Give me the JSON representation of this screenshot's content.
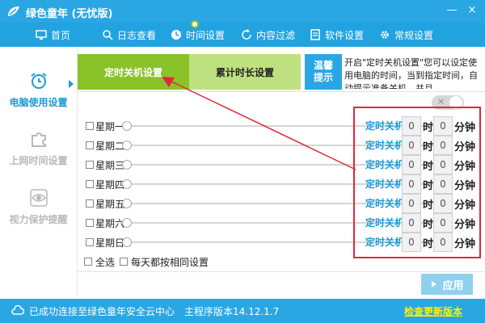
{
  "app": {
    "title": "绿色童年 (无忧版)"
  },
  "window_controls": {
    "minimize": "—",
    "close": "×"
  },
  "menu": [
    {
      "label": "首页",
      "icon": "monitor-icon"
    },
    {
      "label": "日志查看",
      "icon": "search-icon"
    },
    {
      "label": "时间设置",
      "icon": "clock-icon"
    },
    {
      "label": "内容过滤",
      "icon": "refresh-icon"
    },
    {
      "label": "软件设置",
      "icon": "document-icon"
    },
    {
      "label": "常规设置",
      "icon": "gear-icon"
    }
  ],
  "sidebar": [
    {
      "label": "电脑使用设置",
      "icon": "alarm-clock-icon",
      "active": true
    },
    {
      "label": "上网时间设置",
      "icon": "puzzle-icon",
      "active": false
    },
    {
      "label": "视力保护提醒",
      "icon": "eye-icon",
      "active": false
    }
  ],
  "tabs": {
    "shutdown": "定时关机设置",
    "duration": "累计时长设置",
    "tip_label_1": "温馨",
    "tip_label_2": "提示"
  },
  "tip_text": "开启\"定时关机设置\"您可以设定使用电脑的时间，当到指定时间，自动提示准备关机，并且",
  "toggle": {
    "symbol": "×"
  },
  "days": [
    {
      "day": "星期一",
      "off_label": "定时关机",
      "hour": "0",
      "hour_unit": "时",
      "minute": "0",
      "minute_unit": "分钟"
    },
    {
      "day": "星期二",
      "off_label": "定时关机",
      "hour": "0",
      "hour_unit": "时",
      "minute": "0",
      "minute_unit": "分钟"
    },
    {
      "day": "星期三",
      "off_label": "定时关机",
      "hour": "0",
      "hour_unit": "时",
      "minute": "0",
      "minute_unit": "分钟"
    },
    {
      "day": "星期四",
      "off_label": "定时关机",
      "hour": "0",
      "hour_unit": "时",
      "minute": "0",
      "minute_unit": "分钟"
    },
    {
      "day": "星期五",
      "off_label": "定时关机",
      "hour": "0",
      "hour_unit": "时",
      "minute": "0",
      "minute_unit": "分钟"
    },
    {
      "day": "星期六",
      "off_label": "定时关机",
      "hour": "0",
      "hour_unit": "时",
      "minute": "0",
      "minute_unit": "分钟"
    },
    {
      "day": "星期日",
      "off_label": "定时关机",
      "hour": "0",
      "hour_unit": "时",
      "minute": "0",
      "minute_unit": "分钟"
    }
  ],
  "options": {
    "select_all": "全选",
    "same_every_day": "每天都按相同设置"
  },
  "apply": {
    "label": "应用"
  },
  "status": {
    "connection": "已成功连接至绿色童年安全云中心",
    "version": "主程序版本14.12.1.7",
    "update": "检查更新版本"
  },
  "colors": {
    "accent": "#2aa6e3",
    "tab_active": "#8ac22a",
    "tab_inactive": "#bfe080",
    "highlight": "#e0283a",
    "update_link": "#fff200"
  }
}
